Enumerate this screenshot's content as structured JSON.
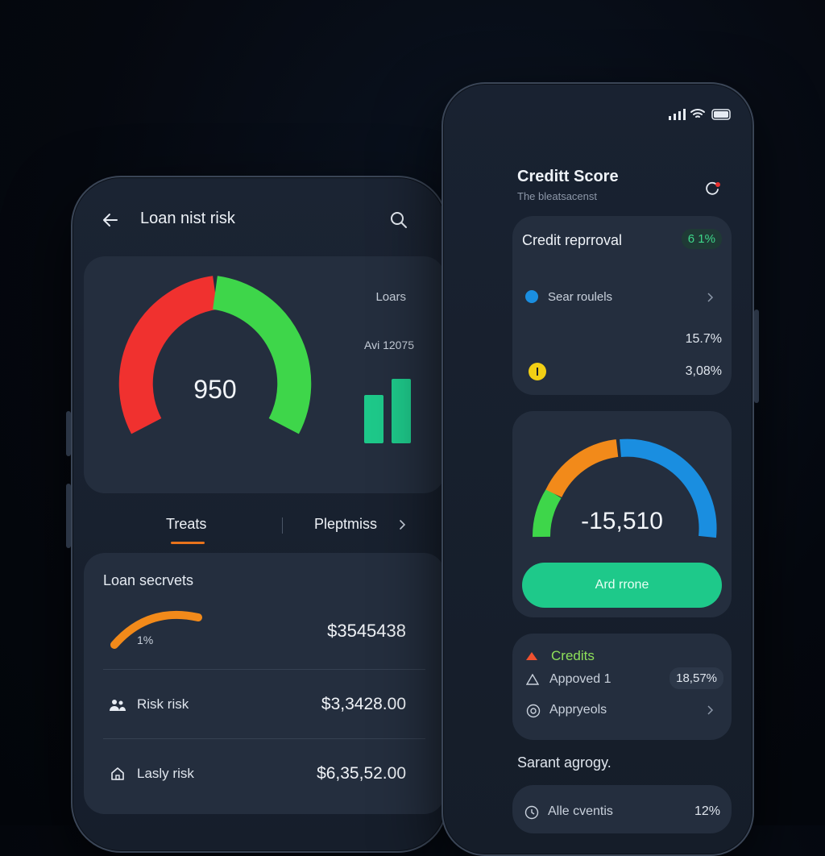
{
  "left_phone": {
    "title": "Loan nist risk",
    "gauge": {
      "value": "950"
    },
    "chart": {
      "label_top": "Loars",
      "label_avg": "Avi 12075",
      "bar_values": [
        0.6,
        0.8
      ]
    },
    "tabs": [
      {
        "label": "Treats",
        "active": true
      },
      {
        "label": "Pleptmiss",
        "active": false
      }
    ],
    "loan_card": {
      "title": "Loan secrvets",
      "progress_label": "1%",
      "progress_amount": "$3545438",
      "rows": [
        {
          "icon": "people-icon",
          "label": "Risk risk",
          "amount": "$3,3428.00"
        },
        {
          "icon": "home-icon",
          "label": "Lasly risk",
          "amount": "$6,35,52.00"
        }
      ]
    }
  },
  "right_phone": {
    "title": "Creditt Score",
    "subtitle": "The bleatsacenst",
    "approval_card": {
      "title": "Credit reprroval",
      "badge": "6 1%",
      "item_label": "Sear roulels",
      "value1": "15.7%",
      "value2": "3,08%"
    },
    "score_card": {
      "value": "-15,510",
      "button_label": "Ard rrone"
    },
    "credits_card": {
      "title": "Credits",
      "row1_label": "Appoved 1",
      "row1_value": "18,57%",
      "row2_label": "Appryeols"
    },
    "section_title": "Sarant agrogy.",
    "bottom_row": {
      "label": "Alle cventis",
      "value": "12%"
    }
  },
  "colors": {
    "red": "#f0312f",
    "green": "#3ed64a",
    "teal": "#1ec98a",
    "orange": "#f28a1a",
    "blue": "#1a8ee0",
    "yellow": "#f2cf14",
    "accent_tab": "#e8731c",
    "credits_green": "#8ee05a"
  }
}
